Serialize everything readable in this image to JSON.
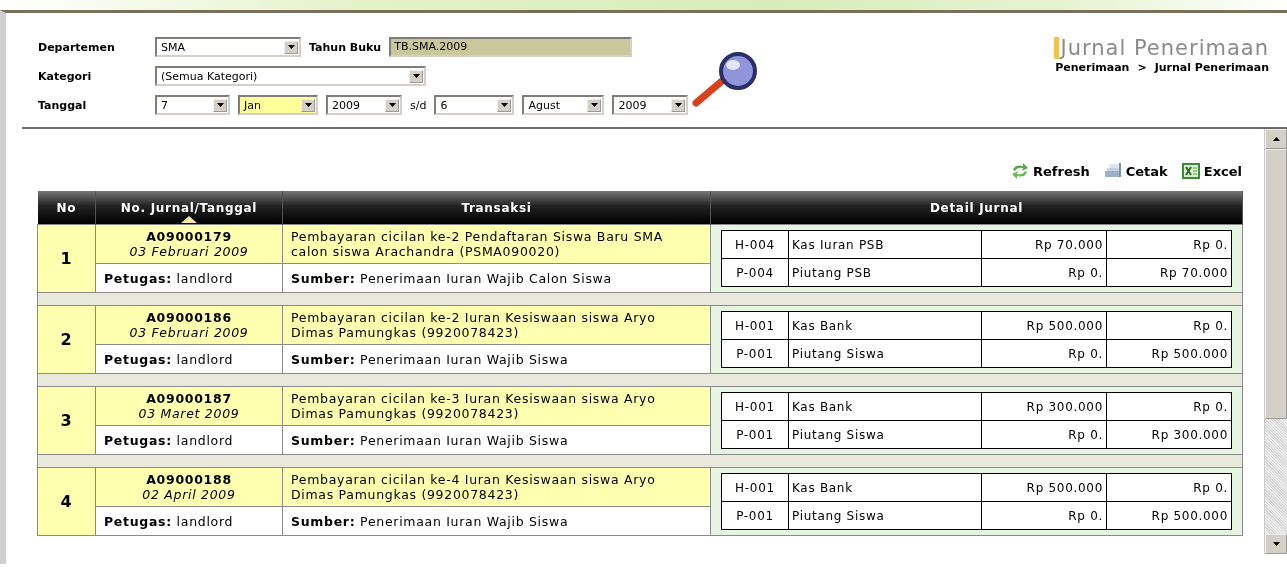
{
  "filters": {
    "departemen": {
      "label": "Departemen",
      "value": "SMA"
    },
    "tahun_buku": {
      "label": "Tahun Buku",
      "value": "TB.SMA.2009"
    },
    "kategori": {
      "label": "Kategori",
      "value": "(Semua Kategori)"
    },
    "tanggal": {
      "label": "Tanggal",
      "separator": "s/d",
      "from": [
        {
          "value": "7",
          "focused": false
        },
        {
          "value": "Jan",
          "focused": true
        },
        {
          "value": "2009",
          "focused": false
        }
      ],
      "to": [
        {
          "value": "6",
          "focused": false
        },
        {
          "value": "Agust",
          "focused": false
        },
        {
          "value": "2009",
          "focused": false
        }
      ]
    }
  },
  "page": {
    "title": "Jurnal Penerimaan",
    "breadcrumb": [
      "Penerimaan",
      ">",
      "Jurnal Penerimaan"
    ]
  },
  "toolbar": [
    {
      "kind": "refresh",
      "label": "Refresh"
    },
    {
      "kind": "print",
      "label": "Cetak"
    },
    {
      "kind": "excel",
      "label": "Excel"
    }
  ],
  "table": {
    "columns": [
      {
        "label": "No",
        "sorted": false
      },
      {
        "label": "No. Jurnal/Tanggal",
        "sorted": true
      },
      {
        "label": "Transaksi",
        "sorted": false
      },
      {
        "label": "Detail Jurnal",
        "sorted": false
      }
    ],
    "rows": [
      {
        "no": "1",
        "journal_no": "A09000179",
        "date": "03 Februari 2009",
        "description": "Pembayaran cicilan ke-2 Pendaftaran Siswa Baru SMA calon siswa Arachandra (PSMA090020)",
        "officer": "**Petugas:** landlord",
        "source": "**Sumber:** Penerimaan Iuran Wajib Calon Siswa",
        "details": [
          {
            "account": "H-004",
            "name": "Kas Iuran PSB",
            "debit": "Rp 70.000",
            "credit": "Rp 0."
          },
          {
            "account": "P-004",
            "name": "Piutang PSB",
            "debit": "Rp 0.",
            "credit": "Rp 70.000"
          }
        ]
      },
      {
        "no": "2",
        "journal_no": "A09000186",
        "date": "03 Februari 2009",
        "description": "Pembayaran cicilan ke-2 Iuran Kesiswaan siswa Aryo Dimas Pamungkas (9920078423)",
        "officer": "**Petugas:** landlord",
        "source": "**Sumber:** Penerimaan Iuran Wajib Siswa",
        "details": [
          {
            "account": "H-001",
            "name": "Kas Bank",
            "debit": "Rp 500.000",
            "credit": "Rp 0."
          },
          {
            "account": "P-001",
            "name": "Piutang Siswa",
            "debit": "Rp 0.",
            "credit": "Rp 500.000"
          }
        ]
      },
      {
        "no": "3",
        "journal_no": "A09000187",
        "date": "03 Maret 2009",
        "description": "Pembayaran cicilan ke-3 Iuran Kesiswaan siswa Aryo Dimas Pamungkas (9920078423)",
        "officer": "**Petugas:** landlord",
        "source": "**Sumber:** Penerimaan Iuran Wajib Siswa",
        "details": [
          {
            "account": "H-001",
            "name": "Kas Bank",
            "debit": "Rp 300.000",
            "credit": "Rp 0."
          },
          {
            "account": "P-001",
            "name": "Piutang Siswa",
            "debit": "Rp 0.",
            "credit": "Rp 300.000"
          }
        ]
      },
      {
        "no": "4",
        "journal_no": "A09000188",
        "date": "02 April 2009",
        "description": "Pembayaran cicilan ke-4 Iuran Kesiswaan siswa Aryo Dimas Pamungkas (9920078423)",
        "officer": "**Petugas:** landlord",
        "source": "**Sumber:** Penerimaan Iuran Wajib Siswa",
        "details": [
          {
            "account": "H-001",
            "name": "Kas Bank",
            "debit": "Rp 500.000",
            "credit": "Rp 0."
          },
          {
            "account": "P-001",
            "name": "Piutang Siswa",
            "debit": "Rp 0.",
            "credit": "Rp 500.000"
          }
        ]
      }
    ]
  }
}
